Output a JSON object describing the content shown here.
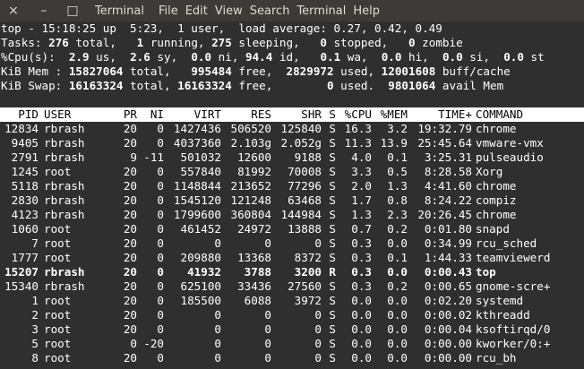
{
  "window": {
    "close_icon": "×",
    "minimize_icon": "–",
    "maximize_icon": "□",
    "title": "Terminal"
  },
  "menu": [
    "File",
    "Edit",
    "View",
    "Search",
    "Terminal",
    "Help"
  ],
  "summary": {
    "line1": "top - 15:18:25 up  5:23,  1 user,  load average: 0.27, 0.42, 0.49",
    "tasks": {
      "label": "Tasks: ",
      "total": "276",
      "total_lbl": " total,   ",
      "running": "1",
      "running_lbl": " running, ",
      "sleeping": "275",
      "sleeping_lbl": " sleeping,   ",
      "stopped": "0",
      "stopped_lbl": " stopped,   ",
      "zombie": "0",
      "zombie_lbl": " zombie"
    },
    "cpu": {
      "label": "%Cpu(s): ",
      "us": " 2.9",
      "us_lbl": " us,  ",
      "sy": "2.6",
      "sy_lbl": " sy,  ",
      "ni": "0.0",
      "ni_lbl": " ni, ",
      "id": "94.4",
      "id_lbl": " id,   ",
      "wa": "0.1",
      "wa_lbl": " wa,  ",
      "hi": "0.0",
      "hi_lbl": " hi,  ",
      "si": "0.0",
      "si_lbl": " si,  ",
      "st": "0.0",
      "st_lbl": " st"
    },
    "mem": {
      "label": "KiB Mem : ",
      "total": "15827064",
      "total_lbl": " total,   ",
      "free": "995484",
      "free_lbl": " free,  ",
      "used": "2829972",
      "used_lbl": " used, ",
      "buff": "12001608",
      "buff_lbl": " buff/cache"
    },
    "swap": {
      "label": "KiB Swap: ",
      "total": "16163324",
      "total_lbl": " total, ",
      "free": "16163324",
      "free_lbl": " free,        ",
      "used": "0",
      "used_lbl": " used.  ",
      "avail": "9801064",
      "avail_lbl": " avail Mem"
    }
  },
  "columns": [
    "PID",
    "USER",
    "PR",
    "NI",
    "VIRT",
    "RES",
    "SHR",
    "S",
    "%CPU",
    "%MEM",
    "TIME+",
    "COMMAND"
  ],
  "processes": [
    [
      "12834",
      "rbrash",
      "20",
      "0",
      "1427436",
      "506520",
      "125840",
      "S",
      "16.3",
      "3.2",
      "19:32.79",
      "chrome"
    ],
    [
      "9405",
      "rbrash",
      "20",
      "0",
      "4037360",
      "2.103g",
      "2.052g",
      "S",
      "11.3",
      "13.9",
      "25:45.64",
      "vmware-vmx"
    ],
    [
      "2791",
      "rbrash",
      "9",
      "-11",
      "501032",
      "12600",
      "9188",
      "S",
      "4.0",
      "0.1",
      "3:25.31",
      "pulseaudio"
    ],
    [
      "1245",
      "root",
      "20",
      "0",
      "557840",
      "81992",
      "70008",
      "S",
      "3.3",
      "0.5",
      "8:28.58",
      "Xorg"
    ],
    [
      "5118",
      "rbrash",
      "20",
      "0",
      "1148844",
      "213652",
      "77296",
      "S",
      "2.0",
      "1.3",
      "4:41.60",
      "chrome"
    ],
    [
      "2830",
      "rbrash",
      "20",
      "0",
      "1545120",
      "121248",
      "63468",
      "S",
      "1.7",
      "0.8",
      "8:24.22",
      "compiz"
    ],
    [
      "4123",
      "rbrash",
      "20",
      "0",
      "1799600",
      "360804",
      "144984",
      "S",
      "1.3",
      "2.3",
      "20:26.45",
      "chrome"
    ],
    [
      "1060",
      "root",
      "20",
      "0",
      "461452",
      "24972",
      "13888",
      "S",
      "0.7",
      "0.2",
      "0:01.80",
      "snapd"
    ],
    [
      "7",
      "root",
      "20",
      "0",
      "0",
      "0",
      "0",
      "S",
      "0.3",
      "0.0",
      "0:34.99",
      "rcu_sched"
    ],
    [
      "1777",
      "root",
      "20",
      "0",
      "209880",
      "13368",
      "8372",
      "S",
      "0.3",
      "0.1",
      "1:44.33",
      "teamviewerd"
    ],
    [
      "15207",
      "rbrash",
      "20",
      "0",
      "41932",
      "3788",
      "3200",
      "R",
      "0.3",
      "0.0",
      "0:00.43",
      "top"
    ],
    [
      "15340",
      "rbrash",
      "20",
      "0",
      "625100",
      "33436",
      "27560",
      "S",
      "0.3",
      "0.2",
      "0:00.65",
      "gnome-scre+"
    ],
    [
      "1",
      "root",
      "20",
      "0",
      "185500",
      "6088",
      "3972",
      "S",
      "0.0",
      "0.0",
      "0:02.20",
      "systemd"
    ],
    [
      "2",
      "root",
      "20",
      "0",
      "0",
      "0",
      "0",
      "S",
      "0.0",
      "0.0",
      "0:00.02",
      "kthreadd"
    ],
    [
      "3",
      "root",
      "20",
      "0",
      "0",
      "0",
      "0",
      "S",
      "0.0",
      "0.0",
      "0:00.04",
      "ksoftirqd/0"
    ],
    [
      "5",
      "root",
      "0",
      "-20",
      "0",
      "0",
      "0",
      "S",
      "0.0",
      "0.0",
      "0:00.00",
      "kworker/0:+"
    ],
    [
      "8",
      "root",
      "20",
      "0",
      "0",
      "0",
      "0",
      "S",
      "0.0",
      "0.0",
      "0:00.00",
      "rcu_bh"
    ]
  ],
  "highlight_pid": "15207"
}
